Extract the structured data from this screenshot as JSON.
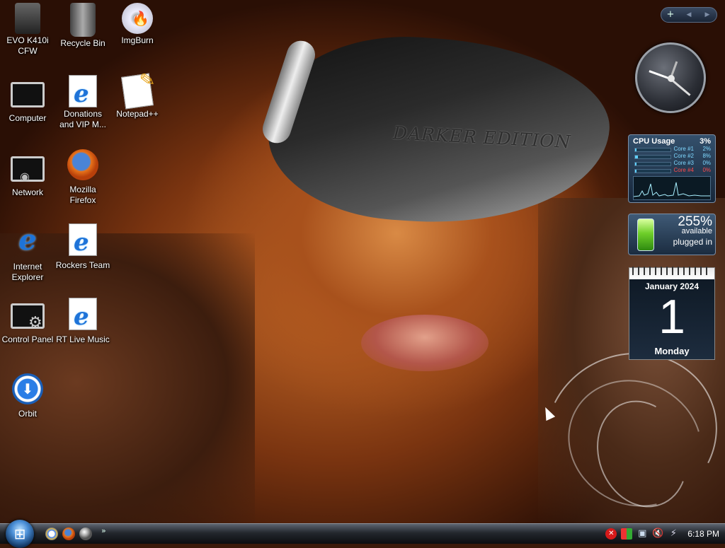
{
  "desktop": {
    "icons": [
      {
        "label": "EVO K410i\nCFW",
        "icon": "folder-drive-icon"
      },
      {
        "label": "Recycle Bin",
        "icon": "recycle-bin-icon"
      },
      {
        "label": "ImgBurn",
        "icon": "imgburn-disc-icon"
      },
      {
        "label": "Computer",
        "icon": "computer-icon"
      },
      {
        "label": "Donations\nand VIP M...",
        "icon": "ie-document-icon"
      },
      {
        "label": "Notepad++",
        "icon": "notepad-plus-icon"
      },
      {
        "label": "Network",
        "icon": "network-icon"
      },
      {
        "label": "Mozilla\nFirefox",
        "icon": "firefox-icon"
      },
      {
        "label": "Internet\nExplorer",
        "icon": "internet-explorer-icon"
      },
      {
        "label": "Rockers Team",
        "icon": "ie-document-icon"
      },
      {
        "label": "Control Panel",
        "icon": "control-panel-icon"
      },
      {
        "label": "RT Live Music",
        "icon": "ie-document-icon"
      },
      {
        "label": "Orbit",
        "icon": "orbit-download-icon"
      }
    ],
    "wallpaper_text": "DARKER EDITION"
  },
  "gadgets": {
    "toolbar": {
      "add": "+",
      "prev": "◀",
      "next": "▶"
    },
    "cpu": {
      "title": "CPU Usage",
      "total": "3%",
      "cores": [
        {
          "name": "Core #1",
          "pct": "2%",
          "level": 0.02
        },
        {
          "name": "Core #2",
          "pct": "8%",
          "level": 0.08
        },
        {
          "name": "Core #3",
          "pct": "0%",
          "level": 0.0
        },
        {
          "name": "Core #4",
          "pct": "0%",
          "level": 0.0
        }
      ]
    },
    "battery": {
      "percent": "255%",
      "available": "available",
      "status": "plugged in"
    },
    "calendar": {
      "month": "January 2024",
      "day": "1",
      "weekday": "Monday"
    }
  },
  "taskbar": {
    "start_icon": "windows-orb-icon",
    "quick_launch": [
      "chrome-icon",
      "firefox-icon",
      "globe-icon"
    ],
    "overflow": "»",
    "time": "6:18 PM"
  },
  "colors": {
    "core_normal": "#7fd8ff",
    "core_hot": "#ff4a4a",
    "taskbar": "#23272d"
  }
}
